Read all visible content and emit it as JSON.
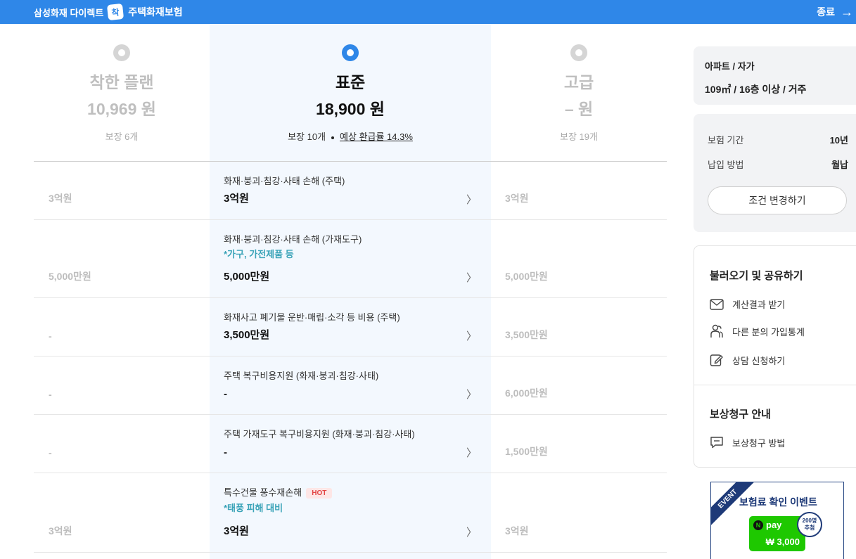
{
  "header": {
    "brand": "삼성화재 다이렉트",
    "brand_logo_char": "착",
    "product": "주택화재보험",
    "close_label": "종료",
    "accent_color": "#2f87e8"
  },
  "plans": [
    {
      "name": "착한 플랜",
      "price": "10,969 원",
      "coverage": "보장 6개",
      "selected": false
    },
    {
      "name": "표준",
      "price": "18,900 원",
      "coverage": "보장 10개",
      "refund": "예상 환급률 14.3%",
      "selected": true
    },
    {
      "name": "고급",
      "price": "– 원",
      "coverage": "보장 19개",
      "selected": false
    }
  ],
  "rows": [
    {
      "title": "화재·붕괴·침강·사태 손해 (주택)",
      "note": "",
      "hot": "",
      "left": "3억원",
      "value": "3억원",
      "right": "3억원"
    },
    {
      "title": "화재·붕괴·침강·사태 손해 (가재도구)",
      "note": "*가구, 가전제품 등",
      "hot": "",
      "left": "5,000만원",
      "value": "5,000만원",
      "right": "5,000만원"
    },
    {
      "title": "화재사고 폐기물 운반·매립·소각 등 비용 (주택)",
      "note": "",
      "hot": "",
      "left": "-",
      "value": "3,500만원",
      "right": "3,500만원"
    },
    {
      "title": "주택 복구비용지원 (화재·붕괴·침강·사태)",
      "note": "",
      "hot": "",
      "left": "-",
      "value": "-",
      "right": "6,000만원"
    },
    {
      "title": "주택 가재도구 복구비용지원 (화재·붕괴·침강·사태)",
      "note": "",
      "hot": "",
      "left": "-",
      "value": "-",
      "right": "1,500만원"
    },
    {
      "title": "특수건물 풍수재손해",
      "note": "*태풍 피해 대비",
      "hot": "HOT",
      "left": "3억원",
      "value": "3억원",
      "right": "3억원"
    }
  ],
  "summary": {
    "type": "아파트 / 자가",
    "detail": "109㎡ / 16층 이상 / 거주",
    "period_label": "보험 기간",
    "period_value": "10년",
    "payment_label": "납입 방법",
    "payment_value": "월납",
    "change_button": "조건 변경하기"
  },
  "share": {
    "title": "불러오기 및 공유하기",
    "items": [
      "계산결과 받기",
      "다른 분의 가입통계",
      "상담 신청하기"
    ]
  },
  "claim": {
    "title": "보상청구 안내",
    "items": [
      "보상청구 방법"
    ]
  },
  "event": {
    "ribbon": "EVENT",
    "title": "보험료 확인 이벤트",
    "npay_logo": "pay",
    "npay_n": "N",
    "amount": "₩ 3,000",
    "badge_top": "200명",
    "badge_bottom": "추첨"
  }
}
